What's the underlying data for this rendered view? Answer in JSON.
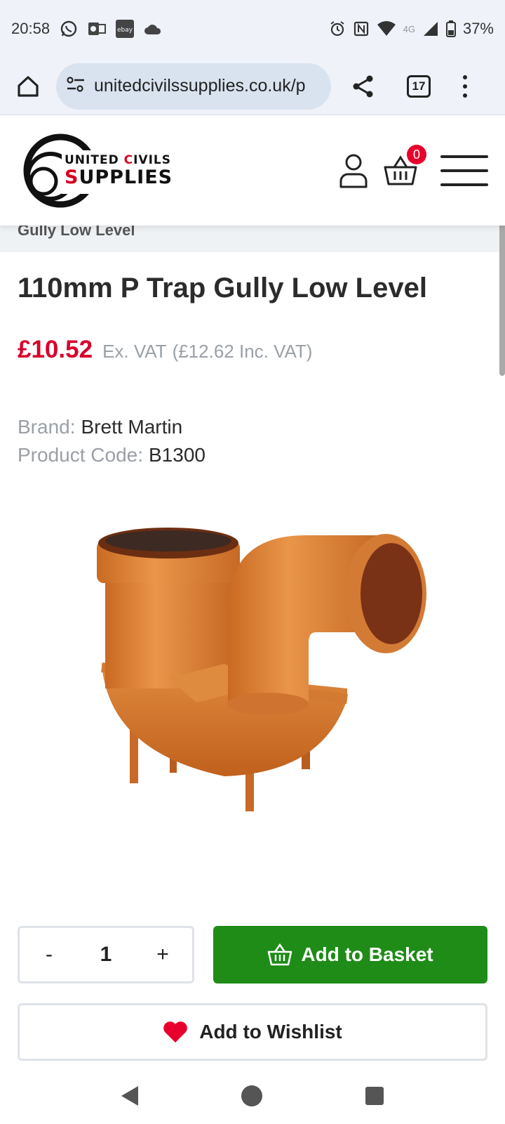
{
  "status_bar": {
    "time": "20:58",
    "notification_icons": [
      "whatsapp-icon",
      "outlook-icon",
      "ebay-icon",
      "cloud-icon"
    ],
    "ebay_label": "ebay",
    "network": "4G",
    "battery": "37%"
  },
  "browser": {
    "url": "unitedcivilssupplies.co.uk/p",
    "tab_count": "17"
  },
  "site": {
    "logo_line1_prefix": "UNITED ",
    "logo_line1_accent": "C",
    "logo_line1_rest": "IVILS",
    "logo_line2_accent": "S",
    "logo_line2_rest": "UPPLIES",
    "basket_count": "0",
    "brand_red": "#d8001f"
  },
  "breadcrumb": {
    "current": "Gully Low Level"
  },
  "product": {
    "title": "110mm P Trap Gully Low Level",
    "price": "£10.52",
    "price_ex_vat_label": "Ex. VAT",
    "price_inc_vat": "(£12.62 Inc. VAT)",
    "brand_label": "Brand:",
    "brand_value": "Brett Martin",
    "code_label": "Product Code:",
    "code_value": "B1300",
    "price_color": "#d8002c"
  },
  "actions": {
    "decrement_label": "-",
    "quantity": "1",
    "increment_label": "+",
    "add_to_basket_label": "Add to Basket",
    "add_to_wishlist_label": "Add to Wishlist",
    "basket_button_color": "#1e8c17"
  }
}
